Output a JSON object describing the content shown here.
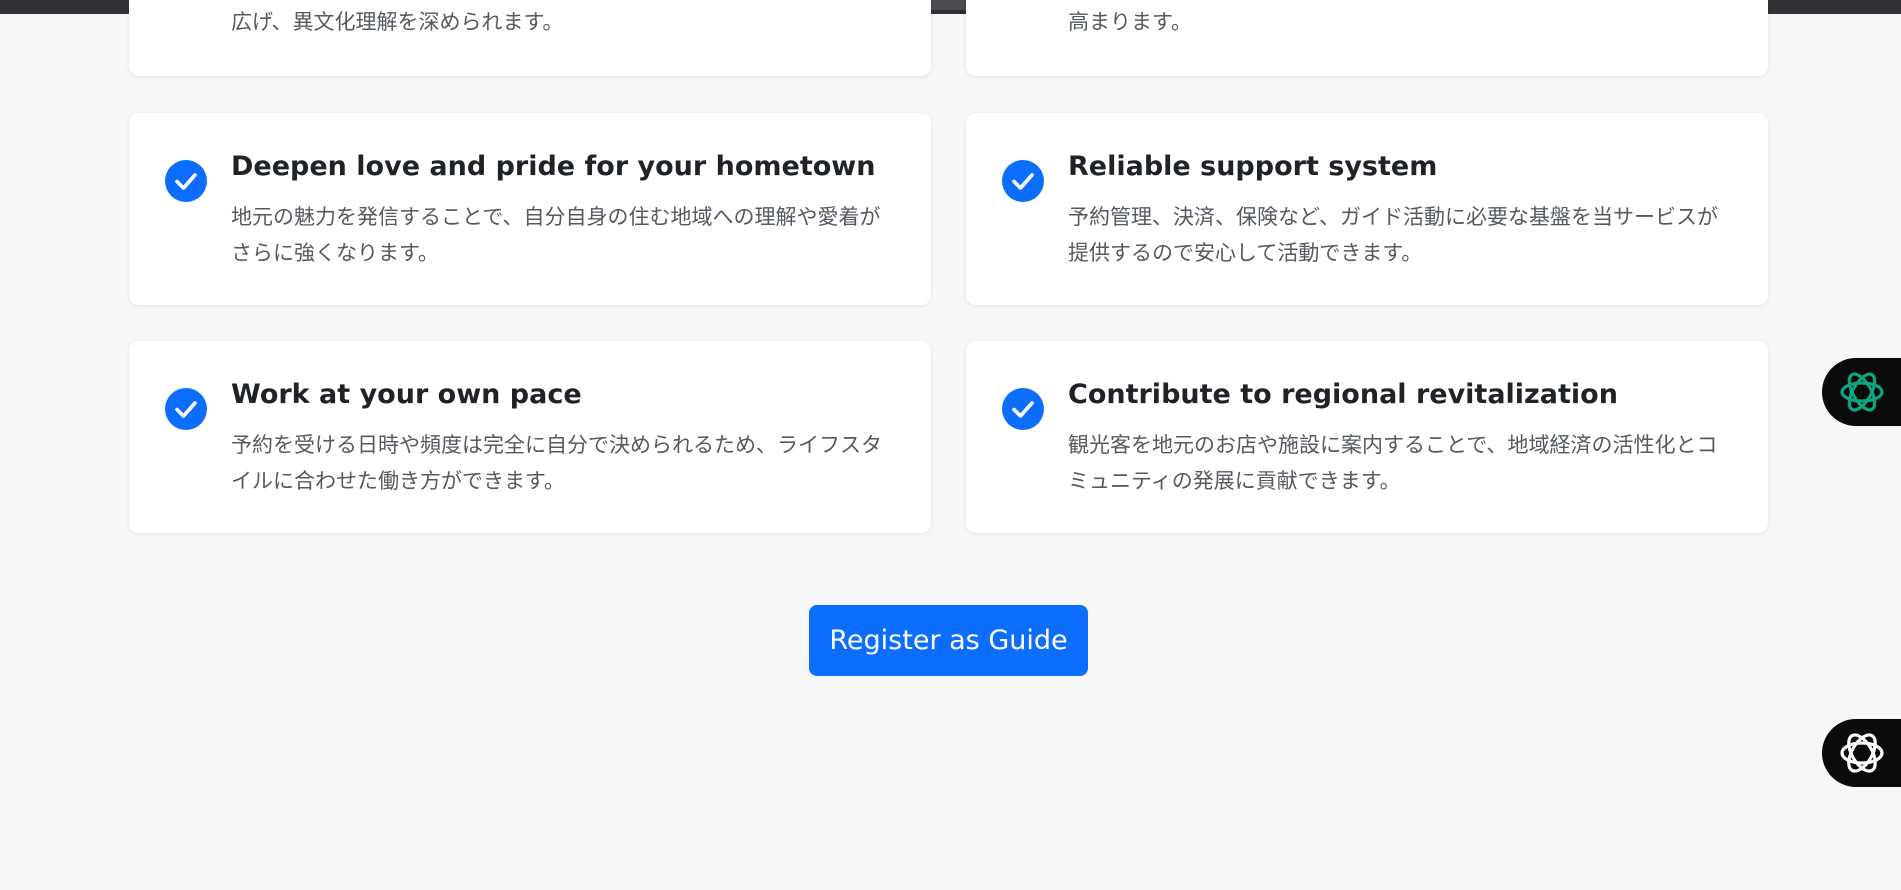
{
  "cards": {
    "top_left_partial": {
      "desc": "広げ、異文化理解を深められます。"
    },
    "top_right_partial": {
      "desc": "高まります。"
    },
    "hometown": {
      "title": "Deepen love and pride for your hometown",
      "desc": "地元の魅力を発信することで、自分自身の住む地域への理解や愛着がさらに強くなります。"
    },
    "support": {
      "title": "Reliable support system",
      "desc": "予約管理、決済、保険など、ガイド活動に必要な基盤を当サービスが提供するので安心して活動できます。"
    },
    "pace": {
      "title": "Work at your own pace",
      "desc": "予約を受ける日時や頻度は完全に自分で決められるため、ライフスタイルに合わせた働き方ができます。"
    },
    "regional": {
      "title": "Contribute to regional revitalization",
      "desc": "観光客を地元のお店や施設に案内することで、地域経済の活性化とコミュニティの発展に貢献できます。"
    }
  },
  "register_button": {
    "label": "Register as Guide"
  },
  "icons": {
    "check": "check-circle-icon",
    "widget_1": "chatgpt-icon",
    "widget_2": "openai-icon"
  },
  "colors": {
    "accent": "#0d6efd",
    "background": "#f6f7f9",
    "widget_green": "#10a37f"
  }
}
